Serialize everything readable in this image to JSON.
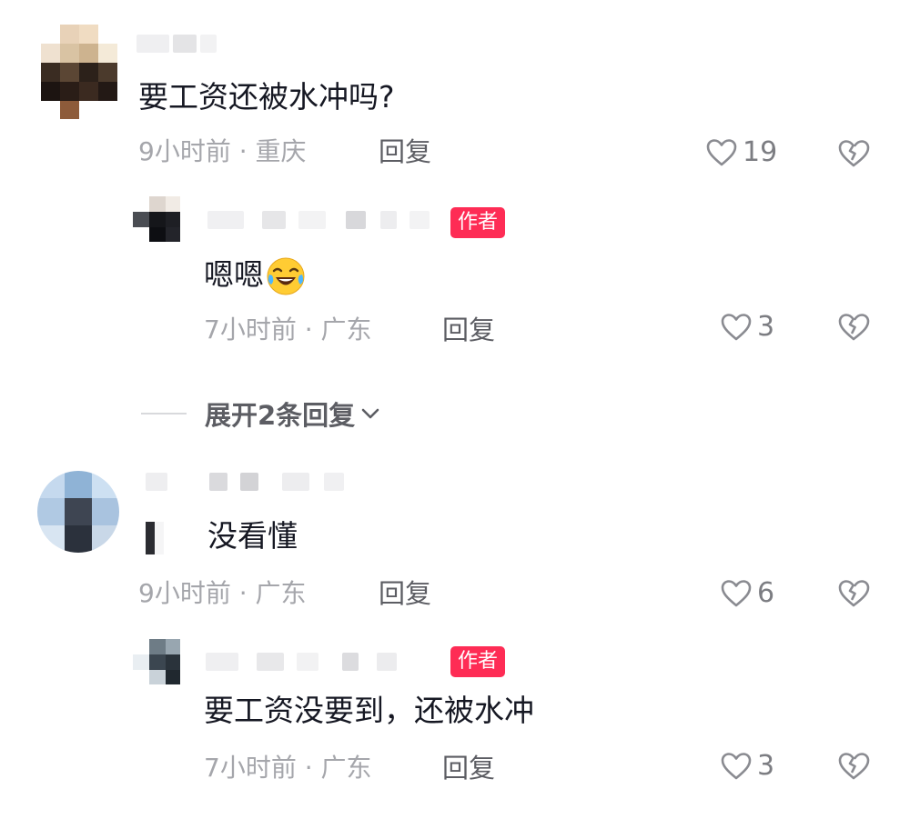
{
  "comments": [
    {
      "text": "要工资还被水冲吗?",
      "time": "9小时前",
      "location": "重庆",
      "reply_label": "回复",
      "likes": "19",
      "replies": [
        {
          "badge": "作者",
          "text": "嗯嗯",
          "emoji": "laughing-crying-emoji",
          "time": "7小时前",
          "location": "广东",
          "reply_label": "回复",
          "likes": "3"
        }
      ],
      "expand_label": "展开2条回复"
    },
    {
      "text": "没看懂",
      "time": "9小时前",
      "location": "广东",
      "reply_label": "回复",
      "likes": "6",
      "replies": [
        {
          "badge": "作者",
          "text": "要工资没要到，还被水冲",
          "time": "7小时前",
          "location": "广东",
          "reply_label": "回复",
          "likes": "3"
        }
      ]
    }
  ],
  "colors": {
    "author_badge": "#fe2c55",
    "text_primary": "#161823",
    "text_meta": "#a5a6ab",
    "icon_gray": "#8a8b91"
  },
  "icons": {
    "like": "heart-icon",
    "dislike": "broken-heart-icon",
    "expand": "chevron-down-icon"
  }
}
